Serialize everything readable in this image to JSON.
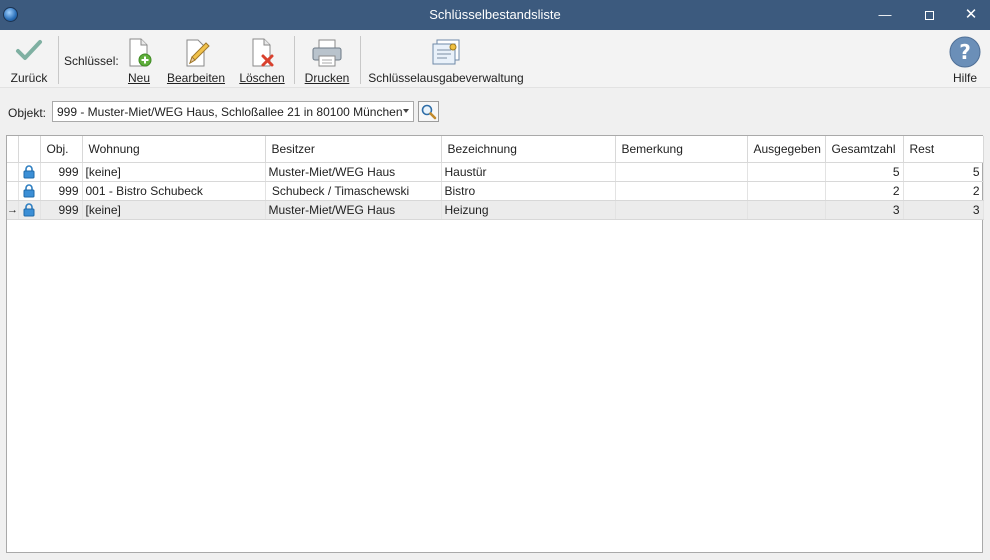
{
  "window": {
    "title": "Schlüsselbestandsliste"
  },
  "toolbar": {
    "back_label": "Zurück",
    "group_label": "Schlüssel:",
    "new_label": "Neu",
    "edit_label": "Bearbeiten",
    "delete_label": "Löschen",
    "print_label": "Drucken",
    "admin_label": "Schlüsselausgabeverwaltung",
    "help_label": "Hilfe"
  },
  "object": {
    "label": "Objekt:",
    "selected": "999 - Muster-Miet/WEG Haus, Schloßallee 21 in 80100 München"
  },
  "table": {
    "columns": [
      "Obj.",
      "Wohnung",
      "Besitzer",
      "Bezeichnung",
      "Bemerkung",
      "Ausgegeben",
      "Gesamtzahl",
      "Rest"
    ],
    "rows": [
      {
        "obj": "999",
        "wohnung": "[keine]",
        "besitzer": "Muster-Miet/WEG Haus",
        "bezeichnung": "Haustür",
        "bemerkung": "",
        "ausgegeben": "",
        "gesamtzahl": "5",
        "rest": "5"
      },
      {
        "obj": "999",
        "wohnung": "001 - Bistro Schubeck",
        "besitzer": " Schubeck / Timaschewski",
        "bezeichnung": "Bistro",
        "bemerkung": "",
        "ausgegeben": "",
        "gesamtzahl": "2",
        "rest": "2"
      },
      {
        "obj": "999",
        "wohnung": "[keine]",
        "besitzer": "Muster-Miet/WEG Haus",
        "bezeichnung": "Heizung",
        "bemerkung": "",
        "ausgegeben": "",
        "gesamtzahl": "3",
        "rest": "3"
      }
    ],
    "current_row_indicator": "→"
  }
}
